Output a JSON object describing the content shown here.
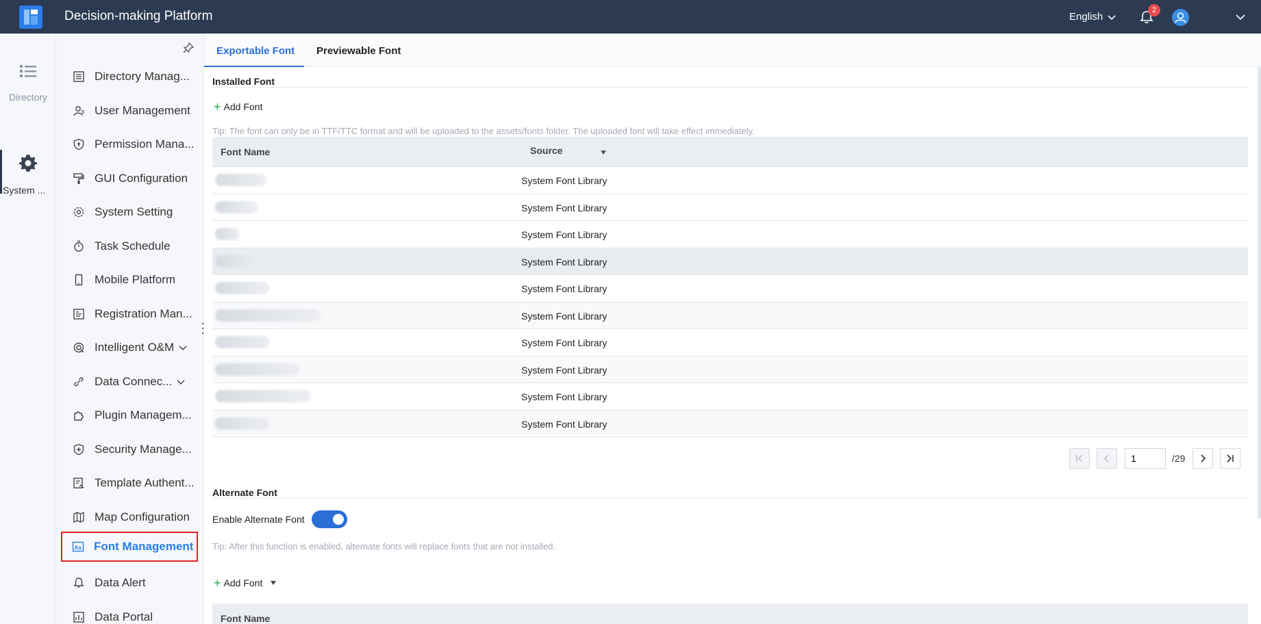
{
  "header": {
    "title": "Decision-making Platform",
    "language": "English",
    "notification_count": "2"
  },
  "rail": {
    "items": [
      {
        "label": "Directory",
        "icon": "list-icon"
      },
      {
        "label": "System ...",
        "icon": "gear-icon"
      }
    ]
  },
  "sidebar": {
    "items": [
      {
        "label": "Directory Manag...",
        "icon": "directory-icon"
      },
      {
        "label": "User Management",
        "icon": "user-icon"
      },
      {
        "label": "Permission Mana...",
        "icon": "shield-icon"
      },
      {
        "label": "GUI Configuration",
        "icon": "paint-roller-icon"
      },
      {
        "label": "System Setting",
        "icon": "gear-icon"
      },
      {
        "label": "Task Schedule",
        "icon": "stopwatch-icon"
      },
      {
        "label": "Mobile Platform",
        "icon": "mobile-icon"
      },
      {
        "label": "Registration Man...",
        "icon": "registration-icon"
      },
      {
        "label": "Intelligent O&M",
        "icon": "om-icon",
        "expandable": true
      },
      {
        "label": "Data Connec...",
        "icon": "link-icon",
        "expandable": true
      },
      {
        "label": "Plugin Managem...",
        "icon": "puzzle-icon"
      },
      {
        "label": "Security Manage...",
        "icon": "security-icon"
      },
      {
        "label": "Template Authent...",
        "icon": "template-icon"
      },
      {
        "label": "Map Configuration",
        "icon": "map-icon"
      },
      {
        "label": "Font Management",
        "icon": "font-icon",
        "active": true
      },
      {
        "label": "Data Alert",
        "icon": "bell-icon"
      },
      {
        "label": "Data Portal",
        "icon": "portal-icon"
      }
    ]
  },
  "tabs": {
    "exportable": "Exportable Font",
    "previewable": "Previewable Font"
  },
  "installed": {
    "title": "Installed Font",
    "add_label": "Add Font",
    "tip": "Tip: The font can only be in TTF/TTC format and will be uploaded to the assets/fonts folder. The uploaded font will take effect immediately.",
    "columns": {
      "name": "Font Name",
      "source": "Source"
    },
    "rows": [
      {
        "source": "System Font Library"
      },
      {
        "source": "System Font Library"
      },
      {
        "source": "System Font Library"
      },
      {
        "source": "System Font Library"
      },
      {
        "source": "System Font Library"
      },
      {
        "source": "System Font Library"
      },
      {
        "source": "System Font Library"
      },
      {
        "source": "System Font Library"
      },
      {
        "source": "System Font Library"
      },
      {
        "source": "System Font Library"
      }
    ]
  },
  "pagination": {
    "current": "1",
    "total": "/29"
  },
  "alternate": {
    "title": "Alternate Font",
    "enable_label": "Enable Alternate Font",
    "enabled": true,
    "tip": "Tip: After this function is enabled, alternate fonts will replace fonts that are not installed.",
    "add_label": "Add Font",
    "column_name": "Font Name"
  },
  "colors": {
    "topbar": "#2c3a52",
    "accent": "#2b6fd6",
    "active_border": "#e02424",
    "badge": "#e84a4a"
  }
}
